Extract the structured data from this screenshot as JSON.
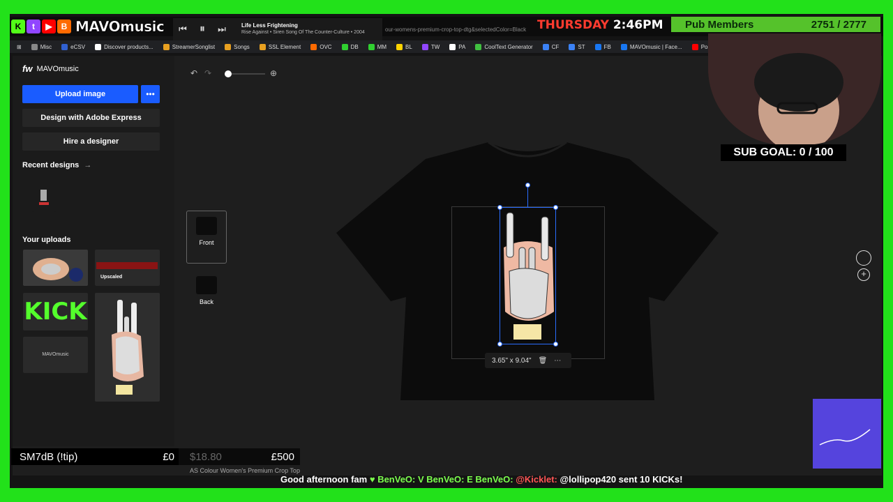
{
  "overlay": {
    "brand": "MAVOmusic",
    "song_title": "Life Less Frightening",
    "song_artist": "Rise Against • Siren Song Of The Counter-Culture • 2004",
    "url_fragment": "our-womens-premium-crop-top-dtg&selectedColor=Black",
    "day": "THURSDAY",
    "time": "2:46PM",
    "pub_label": "Pub Members",
    "pub_count": "2751 / 2777",
    "sub_goal": "SUB GOAL: 0 / 100",
    "tip_label": "SM7dB (!tip)",
    "tip_current": "£0",
    "tip_price": "$18.80",
    "tip_target": "£500",
    "ticker": {
      "message": "Good afternoon fam",
      "u1": "BenVeO:",
      "m1": "V",
      "u2": "BenVeO:",
      "m2": "E",
      "u3": "BenVeO:",
      "u4": "@Kicklet:",
      "m4": "@lollipop420 sent 10 KICKs!"
    }
  },
  "bookmarks": [
    {
      "label": "Misc",
      "color": "#aaaaaa"
    },
    {
      "label": "eCSV",
      "color": "#3060d0"
    },
    {
      "label": "Discover products...",
      "color": "#ffffff"
    },
    {
      "label": "StreamerSonglist",
      "color": "#e8a020"
    },
    {
      "label": "Songs",
      "color": "#e8a020"
    },
    {
      "label": "SSL Element",
      "color": "#e8a020"
    },
    {
      "label": "OVC",
      "color": "#ff6a00"
    },
    {
      "label": "DB",
      "color": "#30d030"
    },
    {
      "label": "MM",
      "color": "#30d030"
    },
    {
      "label": "BL",
      "color": "#ffd400"
    },
    {
      "label": "TW",
      "color": "#9146ff"
    },
    {
      "label": "PA",
      "color": "#ffffff"
    },
    {
      "label": "CoolText Generator",
      "color": "#40c040"
    },
    {
      "label": "CF",
      "color": "#3b82f6"
    },
    {
      "label": "ST",
      "color": "#3b82f6"
    },
    {
      "label": "FB",
      "color": "#1877f2"
    },
    {
      "label": "MAVOmusic | Face...",
      "color": "#1877f2"
    },
    {
      "label": "Posts",
      "color": "#ff0000"
    }
  ],
  "sidebar": {
    "account": "MAVOmusic",
    "upload_label": "Upload image",
    "more_label": "•••",
    "adobe_label": "Design with Adobe Express",
    "hire_label": "Hire a designer",
    "recent_label": "Recent designs",
    "uploads_label": "Your uploads",
    "upscaled_label": "Upscaled",
    "kick_text": "KICK",
    "mavo_text": "MAVOmusic"
  },
  "views": {
    "front_label": "Front",
    "back_label": "Back"
  },
  "canvas": {
    "dimensions": "3.65\" x 9.04\"",
    "product_name": "AS Colour Women's Premium Crop Top"
  }
}
